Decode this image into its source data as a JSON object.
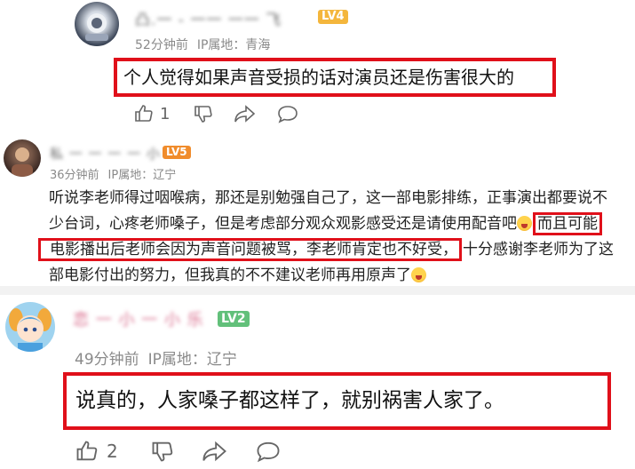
{
  "comments": [
    {
      "username": "凸.一 - 一一 一一 飞",
      "level": "LV4",
      "time": "52分钟前",
      "ip": "IP属地：青海",
      "text": "个人觉得如果声音受损的话对演员还是伤害很大的",
      "likes": "1"
    },
    {
      "username": "私 一 一 一 一 小",
      "level": "LV5",
      "time": "36分钟前",
      "ip": "IP属地：辽宁",
      "lines": [
        "听说李老师得过咽喉病，那还是别勉强自己了，这一部电影排练，正事演出都要说不",
        "少台词，心疼老师嗓子，但是考虑部分观众观影感受还是请使用配音吧",
        "而且可能",
        "电影播出后老师会因为声音问题被骂，李老师肯定也不好受，",
        "十分感谢李老师为了这",
        "部电影付出的努力，但我真的不不建议老师再用原声了"
      ]
    },
    {
      "username": "恋 一 小 一 小 乐",
      "level": "LV2",
      "time": "49分钟前",
      "ip": "IP属地：辽宁",
      "text": "说真的，人家嗓子都这样了，就别祸害人家了。",
      "likes": "2"
    }
  ],
  "colors": {
    "highlight": "#e0101a",
    "lv4": "#f4b63c",
    "lv5": "#f08c2c",
    "lv2": "#62c07a"
  }
}
